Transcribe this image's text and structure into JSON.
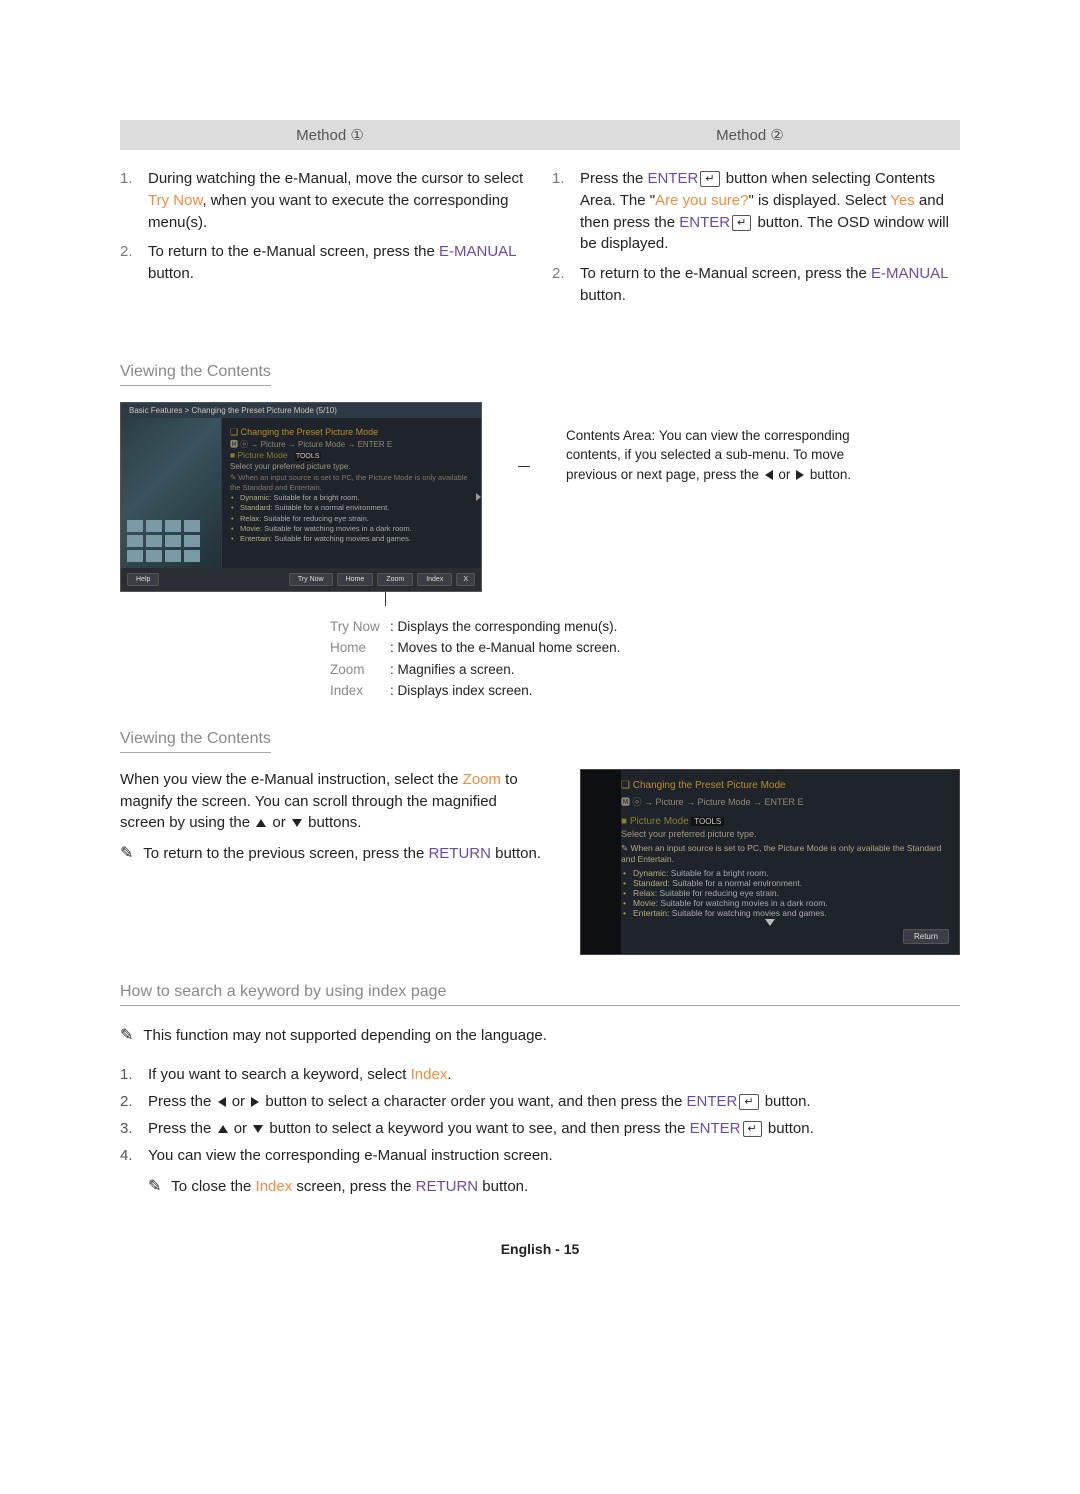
{
  "methods": {
    "left_header": "Method ①",
    "right_header": "Method ②",
    "left_steps": [
      "During watching the e-Manual, move the cursor to select Try Now, when you want to execute the corresponding menu(s).",
      "To return to the e-Manual screen, press the E-MANUAL button."
    ],
    "left_step_markers": [
      "1.",
      "2."
    ],
    "right_steps": [
      "Press the ENTER E button when selecting Contents Area. The \"Are you sure?\" is displayed. Select Yes and then press the ENTER E button. The OSD window will be displayed.",
      "To return to the e-Manual screen, press the E-MANUAL button."
    ],
    "right_step_markers": [
      "1.",
      "2."
    ]
  },
  "section1_title": "Viewing the Contents",
  "content_note": "Contents Area: You can view the corresponding contents, if you selected a sub-menu. To move previous or next page, press the ◄ or ► button.",
  "mock1": {
    "breadcrumb": "Basic Features > Changing the Preset Picture Mode (5/10)",
    "h1": "❑ Changing the Preset Picture Mode",
    "path": "🅼 ⓞ → Picture → Picture Mode → ENTER E",
    "sub": "■ Picture Mode",
    "menu_tool": "TOOLS",
    "hint": "Select your preferred picture type.",
    "note": "✎  When an input source is set to PC, the Picture Mode is only available the Standard and Entertain.",
    "items": [
      {
        "k": "Dynamic",
        "v": ": Suitable for a bright room."
      },
      {
        "k": "Standard",
        "v": ": Suitable for a normal environment."
      },
      {
        "k": "Relax",
        "v": ": Suitable for reducing eye strain."
      },
      {
        "k": "Movie",
        "v": ": Suitable for watching movies in a dark room."
      },
      {
        "k": "Entertain",
        "v": ": Suitable for watching movies and games."
      }
    ],
    "footer": {
      "help": "Help",
      "try": "Try Now",
      "home": "Home",
      "zoom": "Zoom",
      "index": "Index",
      "close": "X"
    }
  },
  "footer_expl": [
    {
      "k": "Try Now",
      "v": ": Displays the corresponding menu(s)."
    },
    {
      "k": "Home",
      "v": ": Moves to the e-Manual home screen."
    },
    {
      "k": "Zoom",
      "v": ": Magnifies a screen."
    },
    {
      "k": "Index",
      "v": ": Displays index screen."
    }
  ],
  "section2_title": "Viewing the Contents",
  "zoom_intro": "When you view the e-Manual instruction, select the Zoom to magnify the screen. You can scroll through the magnified screen by using the ▲ or ▼ buttons.",
  "zoom_note": "To return to the previous screen, press the RETURN button.",
  "mock2": {
    "h1": "❑ Changing the Preset Picture Mode",
    "path": "🅼 ⓞ → Picture → Picture Mode → ENTER E",
    "sub": "■ Picture Mode",
    "menu_tool": "TOOLS",
    "hint": "Select your preferred picture type.",
    "note": "✎  When an input source is set to PC, the Picture Mode is only available the Standard and Entertain.",
    "items": [
      {
        "k": "Dynamic",
        "v": ": Suitable for a bright room."
      },
      {
        "k": "Standard",
        "v": ": Suitable for a normal environment."
      },
      {
        "k": "Relax",
        "v": ": Suitable for reducing eye strain."
      },
      {
        "k": "Movie",
        "v": ": Suitable for watching movies in a dark room."
      },
      {
        "k": "Entertain",
        "v": ": Suitable for watching movies and games."
      }
    ],
    "return": "Return"
  },
  "section3_title": "How to search a keyword by using index page",
  "index_note": "This function may not supported depending on the language.",
  "index_steps": [
    "If you want to search a keyword, select Index.",
    "Press the ◄ or ► button to select a character order you want, and then press the ENTER E button.",
    "Press the ▲ or ▼ button to select a keyword you want to see, and then press the ENTER E button.",
    "You can view the corresponding e-Manual instruction screen."
  ],
  "index_step_markers": [
    "1.",
    "2.",
    "3.",
    "4."
  ],
  "index_close": "To close the Index screen, press the RETURN button.",
  "page_label": "English - 15"
}
